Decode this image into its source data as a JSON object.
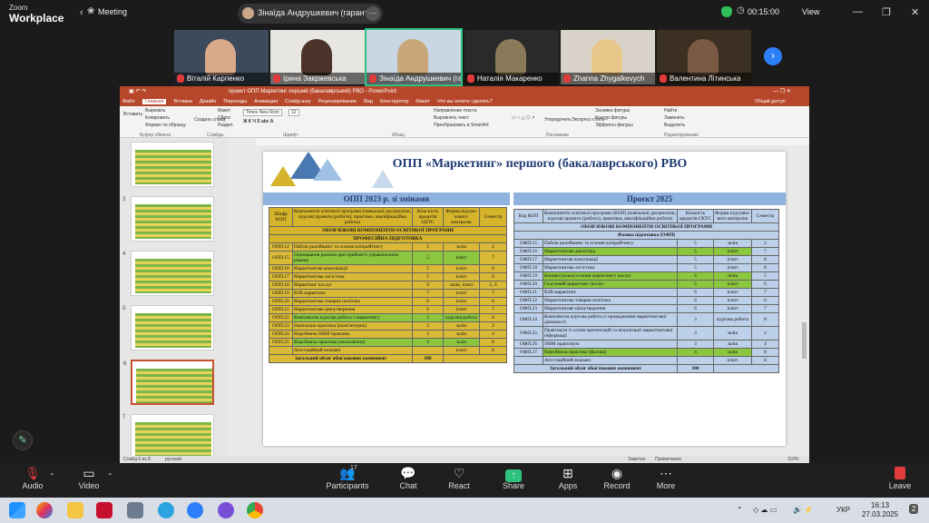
{
  "app": {
    "brand_top": "Zoom",
    "brand_bottom": "Workplace",
    "meeting_tab": "Meeting"
  },
  "presenter": {
    "label": "Зінаїда Андрушкевич (гарант С",
    "more": "⋯"
  },
  "header": {
    "timer": "00:15:00",
    "view": "View"
  },
  "participants_strip": [
    {
      "name": "Віталій Карпенко",
      "bg": "#3d4a5c",
      "head": "#d9a98a",
      "muted": true
    },
    {
      "name": "Ірина Закржевська",
      "bg": "#e8e6e3",
      "head": "#4a3328",
      "muted": true
    },
    {
      "name": "Зінаїда Андрушкевич (га...",
      "bg": "#c9d6e3",
      "head": "#c7a77a",
      "muted": true
    },
    {
      "name": "Наталія Макаренко",
      "bg": "#2a2a2a",
      "head": "#8a7a5a",
      "muted": true
    },
    {
      "name": "Zhanna Zhygalkevych",
      "bg": "#d9d2c8",
      "head": "#e8c88a",
      "muted": true
    },
    {
      "name": "Валентина Літинська",
      "bg": "#3b3022",
      "head": "#7a5a45",
      "muted": true
    }
  ],
  "ppt": {
    "title": "проект ОПП Маркетинг перший (бакалаврський) РВО - PowerPoint",
    "tabs": [
      "Файл",
      "Главная",
      "Вставка",
      "Дизайн",
      "Переходы",
      "Анимация",
      "Слайд-шоу",
      "Рецензирование",
      "Вид",
      "Конструктор",
      "Макет",
      "Что вы хотите сделать?"
    ],
    "ribbon": {
      "groups": [
        "Буфер обмена",
        "Слайды",
        "Шрифт",
        "Абзац",
        "Рисование",
        "Редактирование"
      ],
      "items": [
        "Вставить",
        "Вырезать",
        "Копировать",
        "Формат по образцу",
        "Создать слайд",
        "Макет",
        "Сброс",
        "Раздел",
        "Times New Rom",
        "12",
        "Направление текста",
        "Выровнять текст",
        "Преобразовать в SmartArt",
        "Упорядочить",
        "Экспресс-стили",
        "Заливка фигуры",
        "Контур фигуры",
        "Эффекты фигуры",
        "Найти",
        "Заменить",
        "Выделить"
      ],
      "user": "Общий доступ"
    },
    "status": {
      "slide": "Слайд 6 из 8",
      "lang": "русский",
      "notes": "Заметки",
      "comments": "Примечания",
      "zoom": "110%"
    },
    "thumb_numbers": [
      "",
      "3",
      "4",
      "5",
      "6",
      "7",
      "8"
    ]
  },
  "slide": {
    "title": "ОПП «Маркетинг» першого (бакалаврського) РВО",
    "left_header": "ОПП 2023 р. зі змінами",
    "right_header": "Проєкт 2025",
    "left_table": {
      "headers": [
        "Шифр КОП",
        "Компоненти освітньої програми (навчальні дисципліни, курсові проекти (роботи), практики, кваліфікаційна робота)",
        "Кіль-кість кредитів ЄКТС",
        "Форма підсум-кового контролю",
        "Семестр"
      ],
      "section1": "ОБОВ'ЯЗКОВІ КОМПОНЕНТИ ОСВІТНЬОЇ ПРОГРАМИ",
      "section2": "ПРОФЕСІЙНА ПІДГОТОВКА",
      "rows": [
        {
          "code": "ОПП.14",
          "name": "Паблік рилейшинс та основи копірайтингу",
          "credits": "5",
          "form": "залік",
          "sem": "2",
          "green": false
        },
        {
          "code": "ОПП.15",
          "name": "Оцінювання ризиків при прийнятті управлінських рішень",
          "credits": "5",
          "form": "іспит",
          "sem": "7",
          "green": true
        },
        {
          "code": "ОПП.16",
          "name": "Маркетингові комунікації",
          "credits": "5",
          "form": "іспит",
          "sem": "8",
          "green": false
        },
        {
          "code": "ОПП.17",
          "name": "Маркетингова логістика",
          "credits": "5",
          "form": "іспит",
          "sem": "8",
          "green": false
        },
        {
          "code": "ОПП.18",
          "name": "Маркетинг послуг",
          "credits": "9",
          "form": "залік, іспит",
          "sem": "5, 6",
          "green": false
        },
        {
          "code": "ОПП.19",
          "name": "B2B маркетинг",
          "credits": "7",
          "form": "іспит",
          "sem": "7",
          "green": false
        },
        {
          "code": "ОПП.20",
          "name": "Маркетингова товарна політика",
          "credits": "6",
          "form": "іспит",
          "sem": "6",
          "green": false
        },
        {
          "code": "ОПП.21",
          "name": "Маркетингове ціноутворення",
          "credits": "6",
          "form": "іспит",
          "sem": "7",
          "green": false
        },
        {
          "code": "ОПП.22",
          "name": "Комплексна курсова робота з маркетингу",
          "credits": "3",
          "form": "курсова робота",
          "sem": "8",
          "green": true
        },
        {
          "code": "ОПП.23",
          "name": "Навчальна практика (комп'ютерна)",
          "credits": "3",
          "form": "залік",
          "sem": "2",
          "green": false
        },
        {
          "code": "ОПП.24",
          "name": "Виробнича SMM практика",
          "credits": "3",
          "form": "залік",
          "sem": "4",
          "green": false
        },
        {
          "code": "ОПП.25",
          "name": "Виробнича практика (економічна)",
          "credits": "4",
          "form": "залік",
          "sem": "8",
          "green": true
        },
        {
          "code": "",
          "name": "Атестаційний екзамен",
          "credits": "",
          "form": "іспит",
          "sem": "8",
          "green": false
        }
      ],
      "total_label": "Загальний обсяг обов'язкових компонент",
      "total_value": "180"
    },
    "right_table": {
      "headers": [
        "Код КОП",
        "Компоненти освітньої програми (КОП) (навчальні дисципліни, курсові проекти (роботи), практики, кваліфікаційна робота)",
        "Кількість кредитів ЄКТС",
        "Форма підсумко-вого контролю",
        "Семестр"
      ],
      "section1": "ОБОВ'ЯЗКОВІ КОМПОНЕНТИ ОСВІТНЬОЇ ПРОГРАМИ",
      "section2": "Фахова підготовка (ОФП)",
      "rows": [
        {
          "code": "ОФП.15",
          "name": "Паблік рилейшинс та основи копірайтингу",
          "credits": "5",
          "form": "залік",
          "sem": "2",
          "green": false
        },
        {
          "code": "ОФП.16",
          "name": "Маркетингова аналітика",
          "credits": "5",
          "form": "іспит",
          "sem": "7",
          "green": true
        },
        {
          "code": "ОФП.17",
          "name": "Маркетингові комунікації",
          "credits": "5",
          "form": "іспит",
          "sem": "8",
          "green": false
        },
        {
          "code": "ОФП.18",
          "name": "Маркетингова логістика",
          "credits": "5",
          "form": "іспит",
          "sem": "8",
          "green": false
        },
        {
          "code": "ОФП.19",
          "name": "Концептуальні основи маркетингу послуг",
          "credits": "4",
          "form": "залік",
          "sem": "5",
          "green": true
        },
        {
          "code": "ОФП.20",
          "name": "Галузевий маркетинг послуг",
          "credits": "5",
          "form": "іспит",
          "sem": "6",
          "green": true
        },
        {
          "code": "ОФП.21",
          "name": "B2B маркетинг",
          "credits": "6",
          "form": "іспит",
          "sem": "7",
          "green": false
        },
        {
          "code": "ОФП.22",
          "name": "Маркетингова товарна політика",
          "credits": "6",
          "form": "іспит",
          "sem": "6",
          "green": false
        },
        {
          "code": "ОФП.23",
          "name": "Маркетингове ціноутворення",
          "credits": "6",
          "form": "іспит",
          "sem": "7",
          "green": false
        },
        {
          "code": "ОФП.24",
          "name": "Комплексна курсова робота із провадження маркетингової діяльності",
          "credits": "3",
          "form": "курсова робота",
          "sem": "8",
          "green": false
        },
        {
          "code": "ОФП.25",
          "name": "Практикум із основ презентацій та візуалізації маркетингової інформації",
          "credits": "3",
          "form": "залік",
          "sem": "2",
          "green": false
        },
        {
          "code": "ОФП.26",
          "name": "SMM практикум",
          "credits": "3",
          "form": "залік",
          "sem": "4",
          "green": false
        },
        {
          "code": "ОФП.27",
          "name": "Виробнича практика (фахова)",
          "credits": "4",
          "form": "залік",
          "sem": "8",
          "green": true
        },
        {
          "code": "",
          "name": "Атестаційний екзамен",
          "credits": "",
          "form": "іспит",
          "sem": "8",
          "green": false
        }
      ],
      "total_label": "Загальний обсяг обов'язкових компонент",
      "total_value": "180"
    }
  },
  "toolbar": {
    "audio": "Audio",
    "video": "Video",
    "participants": "Participants",
    "participants_count": "17",
    "chat": "Chat",
    "react": "React",
    "share": "Share",
    "apps": "Apps",
    "record": "Record",
    "more": "More",
    "leave": "Leave"
  },
  "taskbar": {
    "lang": "УКР",
    "time": "16:13",
    "date": "27.03.2025",
    "notifications": "2"
  }
}
